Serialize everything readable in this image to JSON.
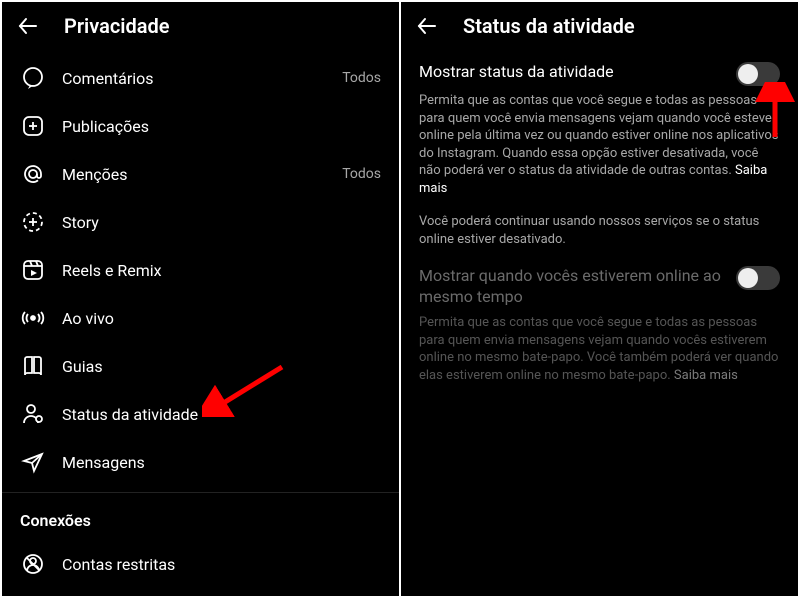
{
  "left": {
    "title": "Privacidade",
    "items": [
      {
        "icon": "comment",
        "label": "Comentários",
        "value": "Todos"
      },
      {
        "icon": "plusbox",
        "label": "Publicações",
        "value": ""
      },
      {
        "icon": "mention",
        "label": "Menções",
        "value": "Todos"
      },
      {
        "icon": "story",
        "label": "Story",
        "value": ""
      },
      {
        "icon": "reels",
        "label": "Reels e Remix",
        "value": ""
      },
      {
        "icon": "live",
        "label": "Ao vivo",
        "value": ""
      },
      {
        "icon": "guides",
        "label": "Guias",
        "value": ""
      },
      {
        "icon": "activity",
        "label": "Status da atividade",
        "value": ""
      },
      {
        "icon": "messages",
        "label": "Mensagens",
        "value": ""
      }
    ],
    "sectionHeader": "Conexões",
    "section2": [
      {
        "icon": "restricted",
        "label": "Contas restritas",
        "value": ""
      }
    ]
  },
  "right": {
    "title": "Status da atividade",
    "setting1": {
      "title": "Mostrar status da atividade",
      "desc": "Permita que as contas que você segue e todas as pessoas para quem você envia mensagens vejam quando você esteve online pela última vez ou quando estiver online nos aplicativos do Instagram. Quando essa opção estiver desativada, você não poderá ver o status da atividade de outras contas. ",
      "more": "Saiba mais"
    },
    "note": "Você poderá continuar usando nossos serviços se o status online estiver desativado.",
    "setting2": {
      "title": "Mostrar quando vocês estiverem online ao mesmo tempo",
      "desc": "Permita que as contas que você segue e todas as pessoas para quem envia mensagens vejam quando vocês estiverem online no mesmo bate-papo. Você também poderá ver quando elas estiverem online no mesmo bate-papo. ",
      "more": "Saiba mais"
    }
  }
}
